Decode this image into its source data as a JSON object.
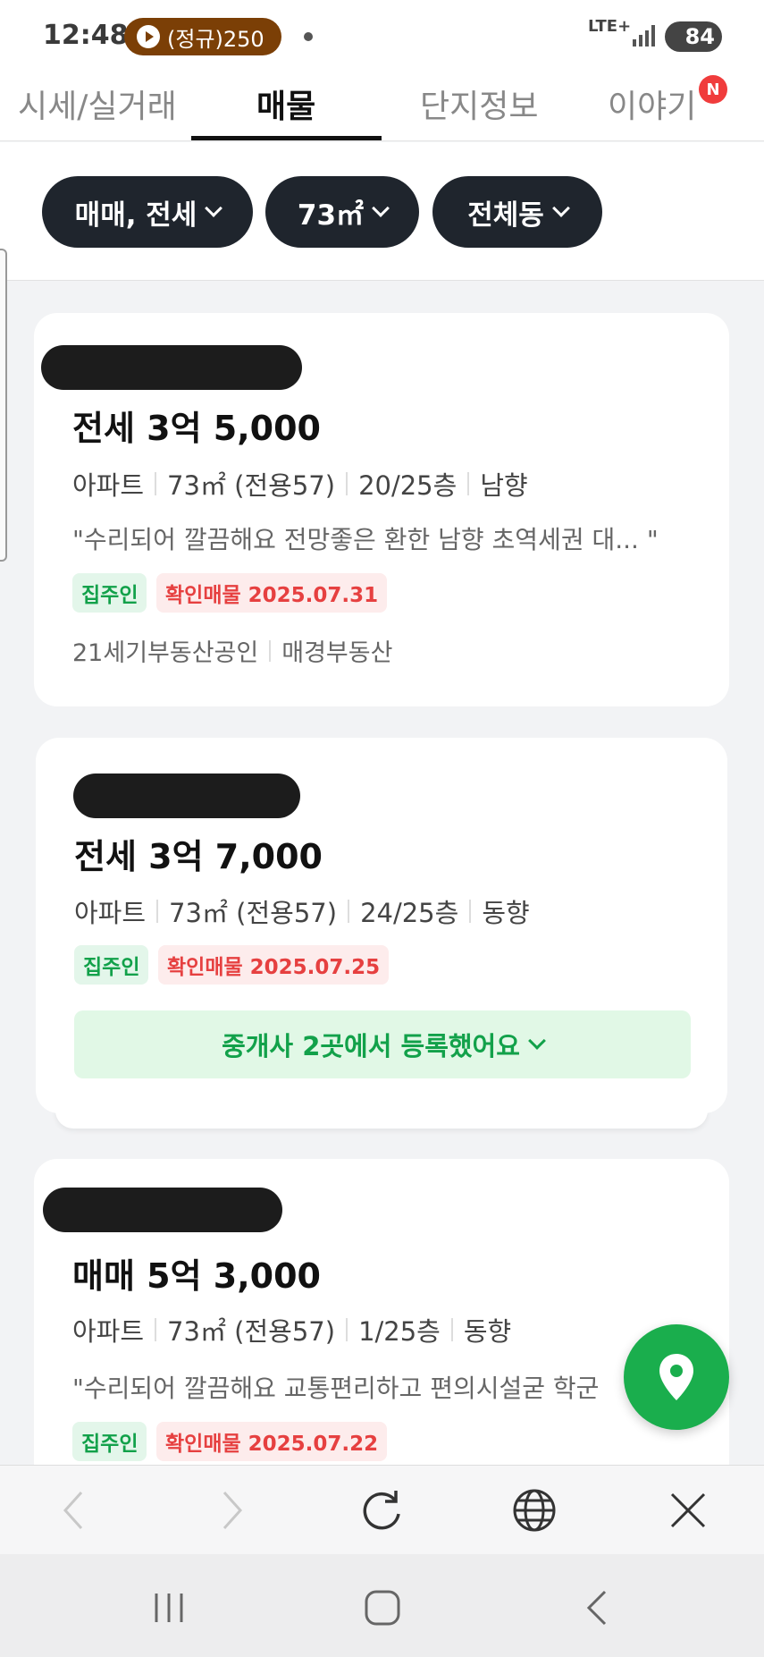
{
  "status_bar": {
    "time": "12:48",
    "media_pill": "(정규)250",
    "network": "LTE+",
    "battery": "84"
  },
  "tabs": [
    {
      "label": "시세/실거래",
      "active": false
    },
    {
      "label": "매물",
      "active": true
    },
    {
      "label": "단지정보",
      "active": false
    },
    {
      "label": "이야기",
      "active": false
    }
  ],
  "tab_badge": "N",
  "filters": [
    {
      "label": "매매, 전세"
    },
    {
      "label": "73㎡"
    },
    {
      "label": "전체동"
    }
  ],
  "listings": [
    {
      "price": "전세 3억 5,000",
      "type": "아파트",
      "area": "73㎡ (전용57)",
      "floor": "20/25층",
      "direction": "남향",
      "description": "\"수리되어 깔끔해요 전망좋은 환한 남향 초역세권 대...   \"",
      "owner_tag": "집주인",
      "verified_tag": "확인매물 2025.07.31",
      "agency_1": "21세기부동산공인",
      "agency_2": "매경부동산"
    },
    {
      "price": "전세 3억 7,000",
      "type": "아파트",
      "area": "73㎡ (전용57)",
      "floor": "24/25층",
      "direction": "동향",
      "owner_tag": "집주인",
      "verified_tag": "확인매물 2025.07.25",
      "broker_button": "중개사 2곳에서 등록했어요"
    },
    {
      "price": "매매 5억 3,000",
      "type": "아파트",
      "area": "73㎡ (전용57)",
      "floor": "1/25층",
      "direction": "동향",
      "description": "\"수리되어 깔끔해요 교통편리하고 편의시설굳 학군",
      "owner_tag": "집주인",
      "verified_tag": "확인매물 2025.07.22"
    }
  ],
  "colors": {
    "accent_green": "#1aae4d",
    "chip_dark": "#1f252d",
    "verified_red": "#e64040",
    "badge_red": "#f03c3c"
  },
  "icons": {
    "fab": "map-pin-icon",
    "browser": [
      "back-arrow-icon",
      "forward-arrow-icon",
      "refresh-icon",
      "globe-icon",
      "close-icon"
    ],
    "system": [
      "recents-icon",
      "home-icon",
      "back-icon"
    ]
  }
}
